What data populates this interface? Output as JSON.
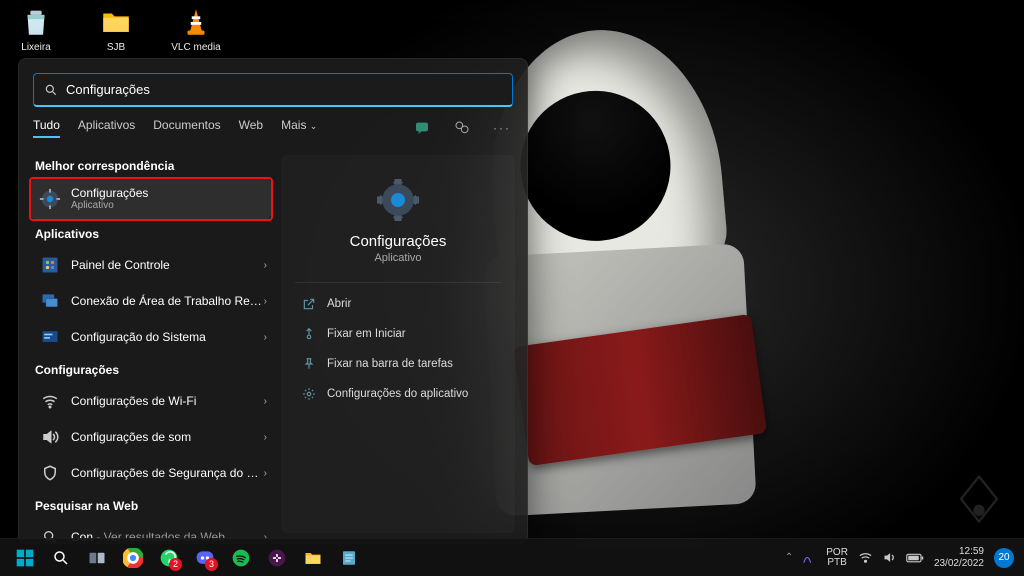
{
  "desktop": {
    "icons": [
      {
        "label": "Lixeira"
      },
      {
        "label": "SJB"
      },
      {
        "label": "VLC media"
      }
    ]
  },
  "search": {
    "query": "Configurações",
    "tabs": {
      "all": "Tudo",
      "apps": "Aplicativos",
      "docs": "Documentos",
      "web": "Web",
      "more": "Mais"
    },
    "sections": {
      "best": "Melhor correspondência",
      "apps": "Aplicativos",
      "settings": "Configurações",
      "web": "Pesquisar na Web"
    },
    "best_match": {
      "title": "Configurações",
      "sub": "Aplicativo"
    },
    "apps": [
      {
        "title": "Painel de Controle"
      },
      {
        "title": "Conexão de Área de Trabalho Remota"
      },
      {
        "title": "Configuração do Sistema"
      }
    ],
    "settings": [
      {
        "title": "Configurações de Wi-Fi"
      },
      {
        "title": "Configurações de som"
      },
      {
        "title": "Configurações de Segurança do Windows"
      }
    ],
    "websearch": {
      "prefix": "Con",
      "suffix": " - Ver resultados da Web"
    },
    "preview": {
      "title": "Configurações",
      "sub": "Aplicativo",
      "actions": {
        "open": "Abrir",
        "pin_start": "Fixar em Iniciar",
        "pin_taskbar": "Fixar na barra de tarefas",
        "app_settings": "Configurações do aplicativo"
      }
    }
  },
  "taskbar": {
    "lang_top": "POR",
    "lang_bottom": "PTB",
    "time": "12:59",
    "date": "23/02/2022",
    "notifications": "20",
    "whatsapp_badge": "2",
    "discord_badge": "3"
  }
}
